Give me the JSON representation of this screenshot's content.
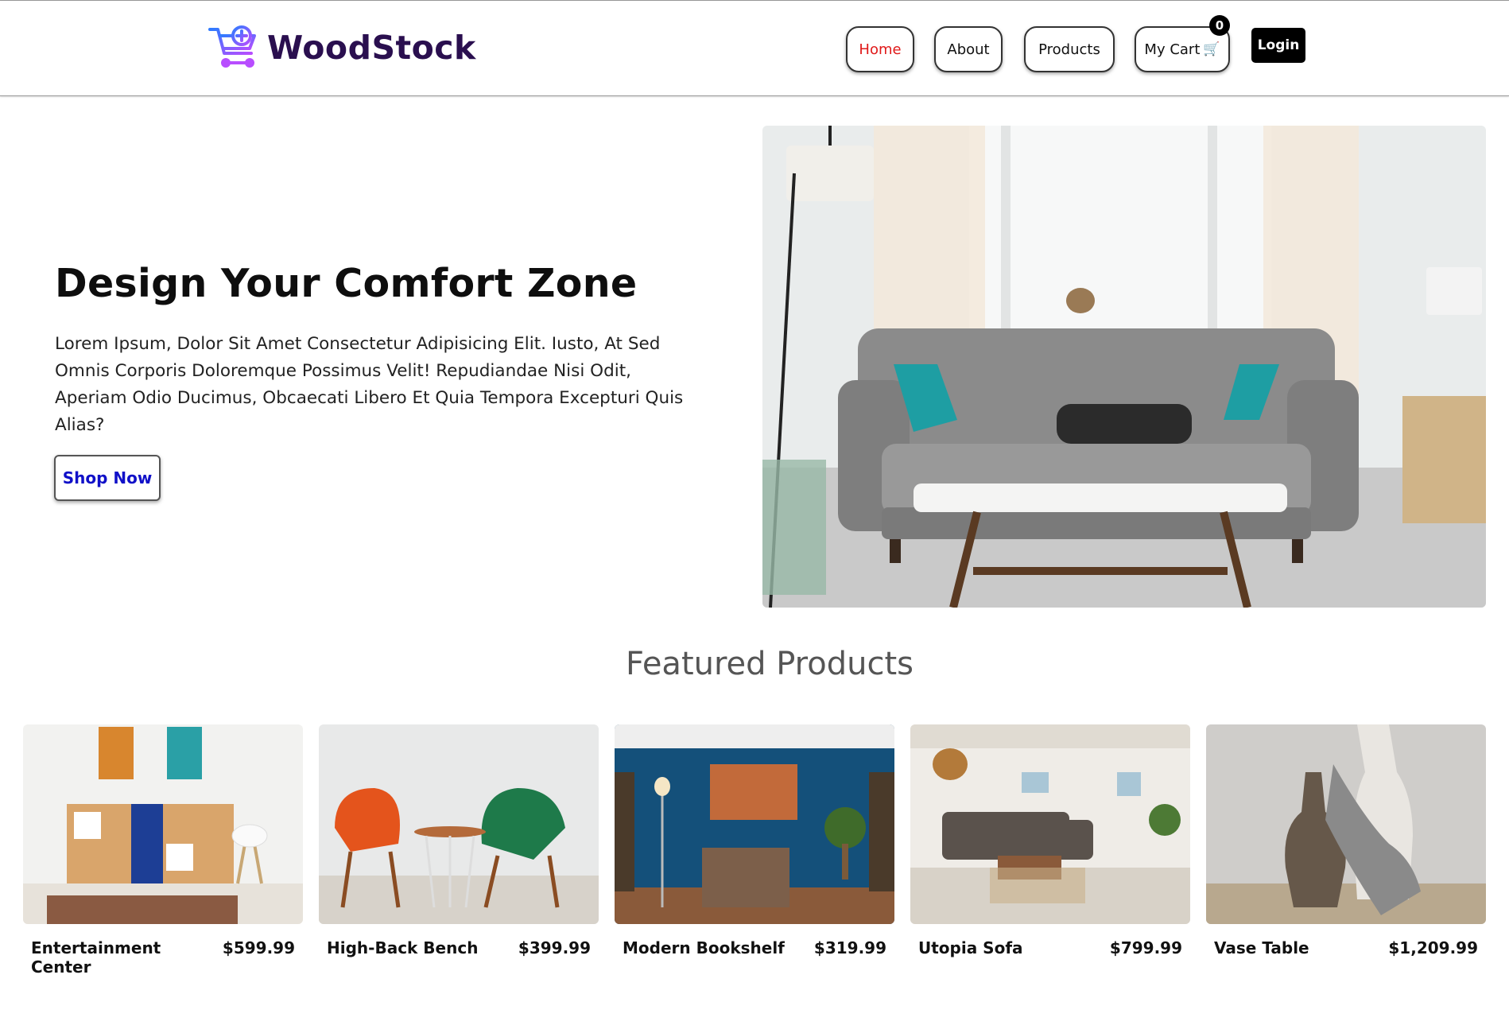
{
  "brand": {
    "name": "WoodStock",
    "logo_icon": "cart-plus-icon"
  },
  "nav": {
    "home": "Home",
    "about": "About",
    "products": "Products",
    "cart": "My Cart",
    "cart_count": "0",
    "login": "Login",
    "active_color": "#e01919"
  },
  "hero": {
    "title": "Design Your Comfort Zone",
    "text": "Lorem Ipsum, Dolor Sit Amet Consectetur Adipisicing Elit. Iusto, At Sed Omnis Corporis Doloremque Possimus Velit! Repudiandae Nisi Odit, Aperiam Odio Ducimus, Obcaecati Libero Et Quia Tempora Excepturi Quis Alias?",
    "cta": "Shop Now",
    "image": "living-room-sofa-photo"
  },
  "featured": {
    "title": "Featured Products",
    "products": [
      {
        "name": "Entertainment Center",
        "price": "$599.99",
        "image": "entertainment-center-photo"
      },
      {
        "name": "High-Back Bench",
        "price": "$399.99",
        "image": "chairs-photo"
      },
      {
        "name": "Modern Bookshelf",
        "price": "$319.99",
        "image": "bookshelf-room-photo"
      },
      {
        "name": "Utopia Sofa",
        "price": "$799.99",
        "image": "sofa-room-photo"
      },
      {
        "name": "Vase Table",
        "price": "$1,209.99",
        "image": "vase-photo"
      }
    ]
  }
}
